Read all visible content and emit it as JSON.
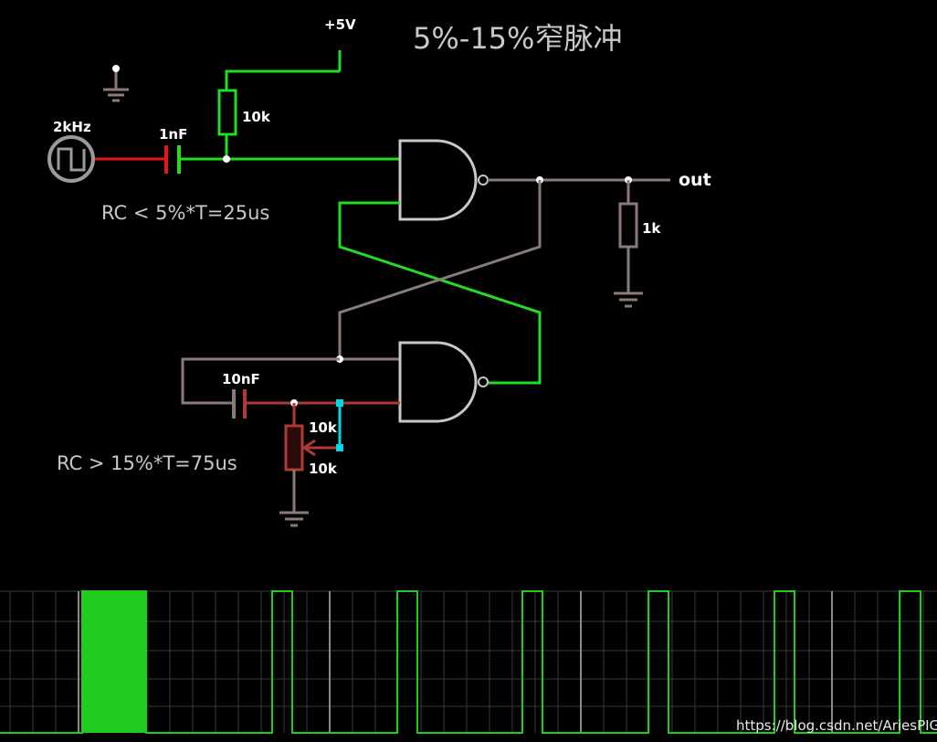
{
  "title": "5%-15%窄脉冲",
  "labels": {
    "supply": "+5V",
    "source_freq": "2kHz",
    "cap_input": "1nF",
    "res_pullup": "10k",
    "res_load": "1k",
    "cap_timing": "10nF",
    "pot_value": "10k",
    "pot_wiper_value": "10k",
    "output": "out"
  },
  "notes": {
    "rc_upper": "RC < 5%*T=25us",
    "rc_lower": "RC > 15%*T=75us"
  },
  "watermark": "https://blog.csdn.net/AriesPIG",
  "colors": {
    "background": "#000000",
    "wire_high": "#22dd22",
    "wire_low": "#8b7b78",
    "wire_red": "#e01818",
    "wire_darkred": "#b03a36",
    "wire_cyan": "#00d8e8",
    "gate": "#c8c8c8",
    "trace": "#1fcc1f",
    "grid": "#3a3a3a"
  },
  "scope": {
    "waveform": "narrow positive pulses",
    "pulse_count_visible": 6
  }
}
